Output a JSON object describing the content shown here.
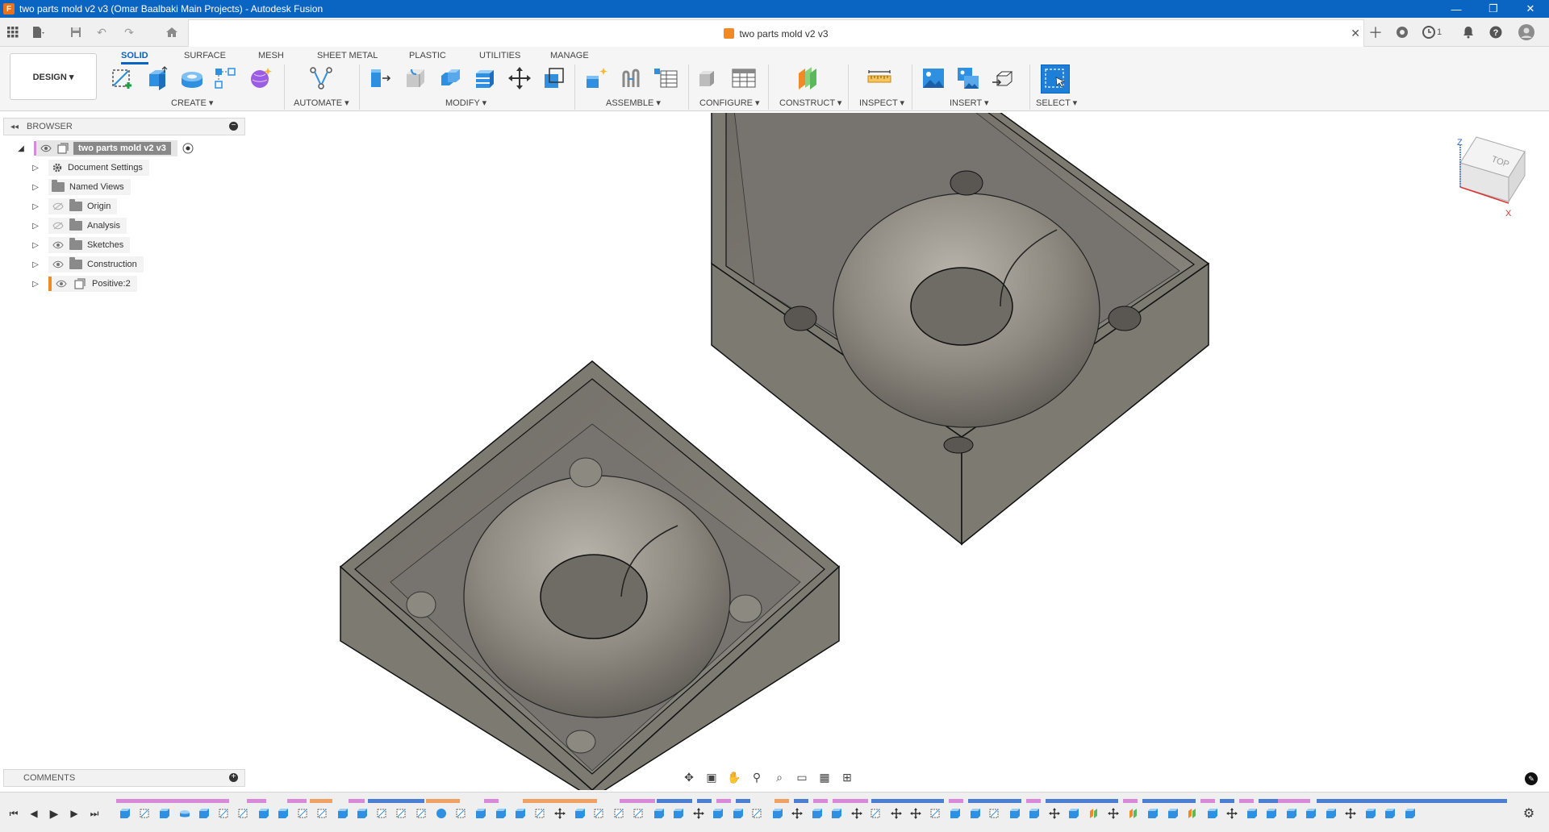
{
  "window": {
    "title": "two parts mold v2 v3 (Omar Baalbaki Main Projects) - Autodesk Fusion",
    "controls": [
      "—",
      "❐",
      "✕"
    ]
  },
  "document_tab": {
    "title": "two parts mold v2 v3",
    "close": "✕"
  },
  "quick_access": {
    "notification_count": "1"
  },
  "ribbon": {
    "workspace": "DESIGN ▾",
    "tabs": [
      "SOLID",
      "SURFACE",
      "MESH",
      "SHEET METAL",
      "PLASTIC",
      "UTILITIES",
      "MANAGE"
    ],
    "groups": [
      "CREATE ▾",
      "AUTOMATE ▾",
      "MODIFY ▾",
      "ASSEMBLE ▾",
      "CONFIGURE ▾",
      "CONSTRUCT ▾",
      "INSPECT ▾",
      "INSERT ▾",
      "SELECT ▾"
    ]
  },
  "browser": {
    "header": "BROWSER",
    "root": "two parts mold v2 v3",
    "items": [
      "Document Settings",
      "Named Views",
      "Origin",
      "Analysis",
      "Sketches",
      "Construction",
      "Positive:2"
    ]
  },
  "comments": {
    "header": "COMMENTS"
  },
  "viewcube": {
    "face": "TOP",
    "axis_x": "X",
    "axis_z": "Z"
  },
  "colors": {
    "title_bar": "#0a64c2",
    "accent": "#0a64c2",
    "mold_body": "#7d7a72",
    "timeline_pink": "#d88ad8",
    "timeline_blue": "#4a7fd4",
    "timeline_orange": "#f0a060"
  }
}
